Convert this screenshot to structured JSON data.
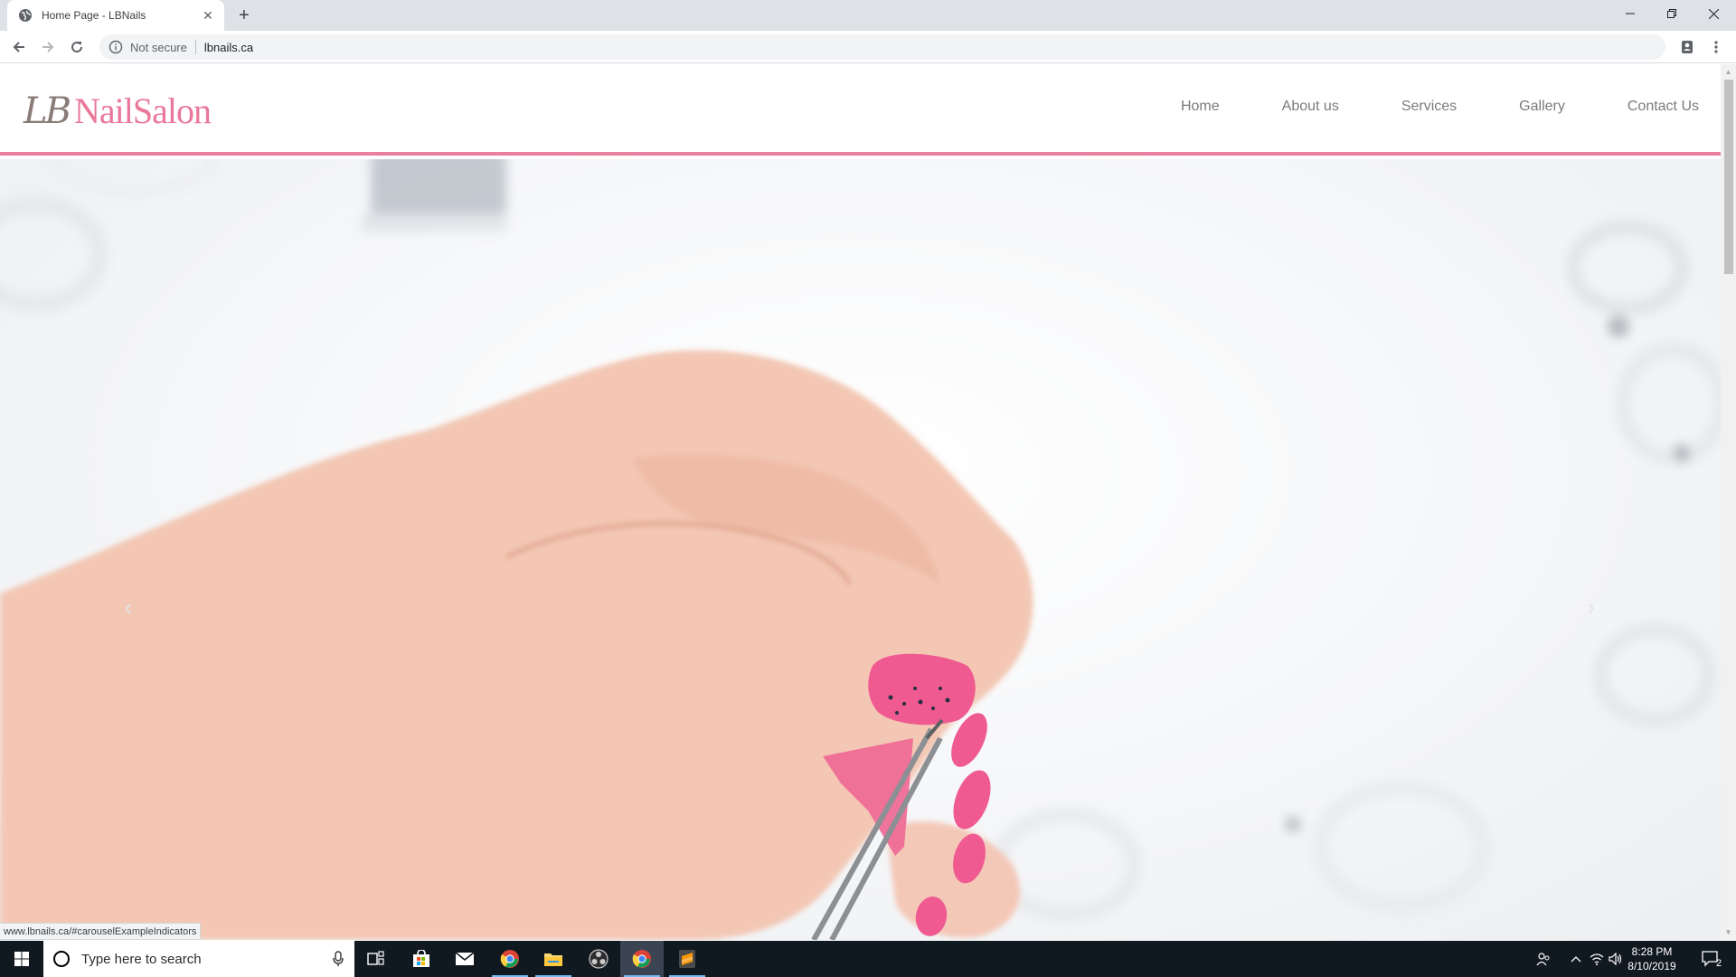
{
  "browser": {
    "tab_title": "Home Page - LBNails",
    "security_label": "Not secure",
    "url": "lbnails.ca",
    "status_url": "www.lbnails.ca/#carouselExampleIndicators"
  },
  "site": {
    "logo_lb": "LB",
    "logo_name": "NailSalon",
    "nav": [
      "Home",
      "About us",
      "Services",
      "Gallery",
      "Contact Us"
    ],
    "accent_color": "#e8819f",
    "carousel_prev": "‹",
    "carousel_next": "›"
  },
  "taskbar": {
    "search_placeholder": "Type here to search",
    "time": "8:28 PM",
    "date": "8/10/2019",
    "notification_count": "2"
  }
}
